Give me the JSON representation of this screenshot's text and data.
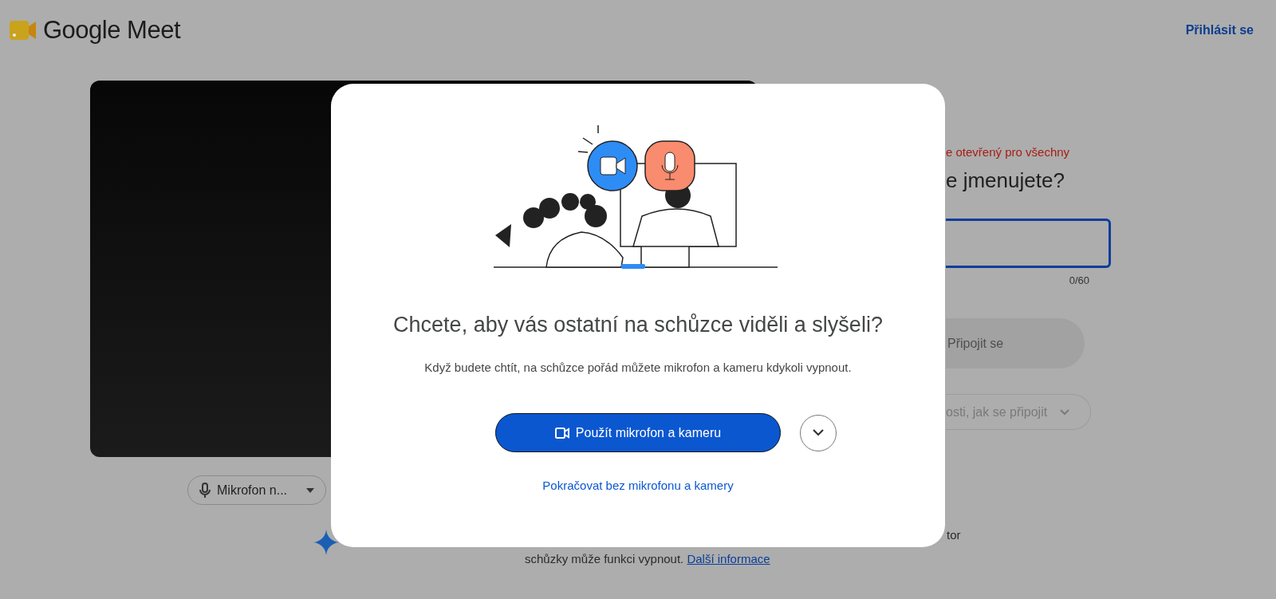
{
  "header": {
    "logo_text": "Google Meet",
    "sign_in": "Přihlásit se"
  },
  "preview": {
    "mic_button": "Mikrofon n..."
  },
  "join_panel": {
    "notice": "e otevřený pro všechny",
    "question": "e jmenujete?",
    "name_field": {
      "counter": "0/60"
    },
    "join_button": {
      "label": "Připojit se",
      "disabled": true
    },
    "options_button": "osti, jak se připojit"
  },
  "footer_note": {
    "text_end": "tor",
    "text": "schůzky může funkci vypnout.",
    "link": "Další informace"
  },
  "dialog": {
    "title": "Chcete, aby vás ostatní na schůzce viděli a slyšeli?",
    "message": "Když budete chtít, na schůzce pořád můžete mikrofon a kameru kdykoli vypnout.",
    "primary_button": "Použít mikrofon a kameru",
    "secondary_link": "Pokračovat bez mikrofonu a kamery"
  }
}
